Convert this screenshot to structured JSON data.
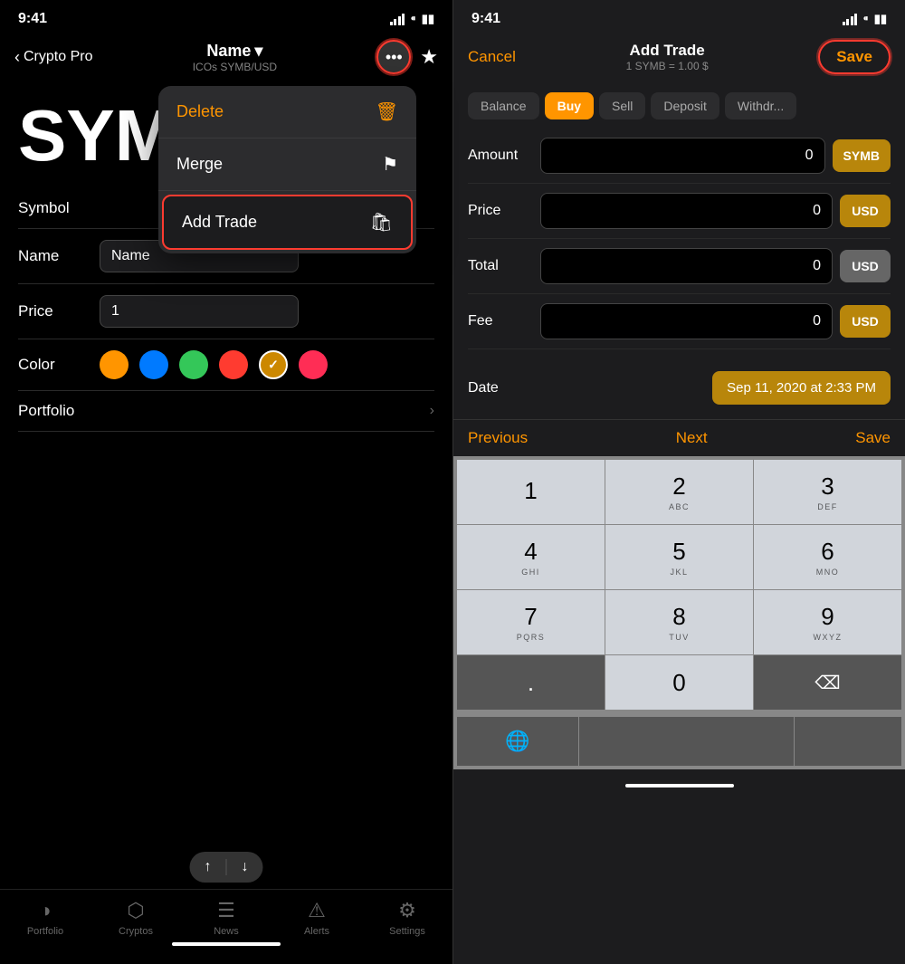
{
  "left": {
    "statusBar": {
      "time": "9:41",
      "icons": [
        "signal",
        "wifi",
        "battery"
      ]
    },
    "header": {
      "backLabel": "Crypto Pro",
      "titleName": "Name",
      "titleChevron": "▾",
      "subtitle": "ICOs SYMB/USD",
      "moreBtn": "•••",
      "starBtn": "★"
    },
    "dropdown": {
      "items": [
        {
          "label": "Delete",
          "icon": "🗑"
        },
        {
          "label": "Merge",
          "icon": "⚑"
        },
        {
          "label": "Add Trade",
          "icon": "🛍"
        }
      ]
    },
    "symbolText": "SYM",
    "formRows": [
      {
        "label": "Symbol",
        "type": "text",
        "value": ""
      },
      {
        "label": "Name",
        "type": "input",
        "value": "Name"
      },
      {
        "label": "Price",
        "type": "input",
        "value": "1"
      },
      {
        "label": "Color",
        "type": "colors"
      },
      {
        "label": "Portfolio",
        "type": "arrow"
      }
    ],
    "colors": [
      "#ff9500",
      "#007aff",
      "#34c759",
      "#ff3b30",
      "#ff9500-selected",
      "#ff2d55"
    ],
    "scrollUp": "↑",
    "scrollDown": "↓",
    "bottomNav": [
      {
        "label": "Portfolio",
        "icon": "portfolio",
        "active": false
      },
      {
        "label": "Cryptos",
        "icon": "cryptos",
        "active": false
      },
      {
        "label": "News",
        "icon": "news",
        "active": false
      },
      {
        "label": "Alerts",
        "icon": "alerts",
        "active": false
      },
      {
        "label": "Settings",
        "icon": "settings",
        "active": false
      }
    ]
  },
  "right": {
    "statusBar": {
      "time": "9:41"
    },
    "header": {
      "cancelLabel": "Cancel",
      "title": "Add Trade",
      "subtitle": "1 SYMB = 1.00 $",
      "saveLabel": "Save"
    },
    "tradeTabs": [
      "Balance",
      "Buy",
      "Sell",
      "Deposit",
      "Withdr..."
    ],
    "activeTab": "Buy",
    "fields": [
      {
        "label": "Amount",
        "value": "0",
        "currency": "SYMB",
        "currencyStyle": "symb"
      },
      {
        "label": "Price",
        "value": "0",
        "currency": "USD",
        "currencyStyle": "usd"
      },
      {
        "label": "Total",
        "value": "0",
        "currency": "USD",
        "currencyStyle": "usd-disabled"
      },
      {
        "label": "Fee",
        "value": "0",
        "currency": "USD",
        "currencyStyle": "usd"
      }
    ],
    "date": {
      "label": "Date",
      "value": "Sep 11, 2020 at 2:33 PM"
    },
    "keyboardToolbar": {
      "previous": "Previous",
      "next": "Next",
      "save": "Save"
    },
    "numpad": [
      {
        "num": "1",
        "sub": ""
      },
      {
        "num": "2",
        "sub": "ABC"
      },
      {
        "num": "3",
        "sub": "DEF"
      },
      {
        "num": "4",
        "sub": "GHI"
      },
      {
        "num": "5",
        "sub": "JKL"
      },
      {
        "num": "6",
        "sub": "MNO"
      },
      {
        "num": "7",
        "sub": "PQRS"
      },
      {
        "num": "8",
        "sub": "TUV"
      },
      {
        "num": "9",
        "sub": "WXYZ"
      },
      {
        "num": ".",
        "sub": ""
      },
      {
        "num": "0",
        "sub": ""
      },
      {
        "num": "⌫",
        "sub": ""
      }
    ]
  }
}
